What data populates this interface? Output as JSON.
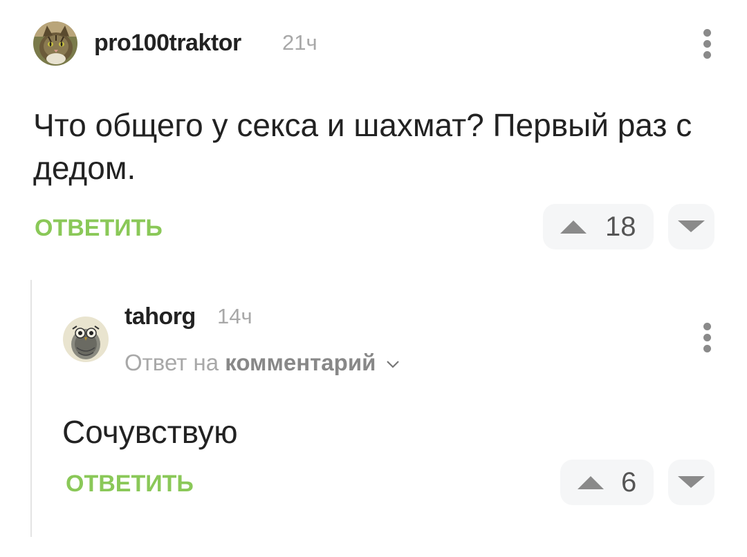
{
  "comment": {
    "username": "pro100traktor",
    "time": "21ч",
    "text": "Что общего у секса и шахмат? Первый раз с дедом.",
    "reply_label": "ОТВЕТИТЬ",
    "score": "18",
    "avatar_icon": "cat-photo-avatar"
  },
  "reply": {
    "username": "tahorg",
    "time": "14ч",
    "reply_to_prefix": "Ответ на",
    "reply_to_link": "комментарий",
    "text": "Сочувствую",
    "reply_label": "ОТВЕТИТЬ",
    "score": "6",
    "avatar_icon": "owl-drawing-avatar"
  },
  "colors": {
    "accent_green": "#8ac858",
    "muted_gray": "#a8a8a8",
    "pill_bg": "#f5f6f7",
    "arrow_gray": "#8a8a8a"
  }
}
